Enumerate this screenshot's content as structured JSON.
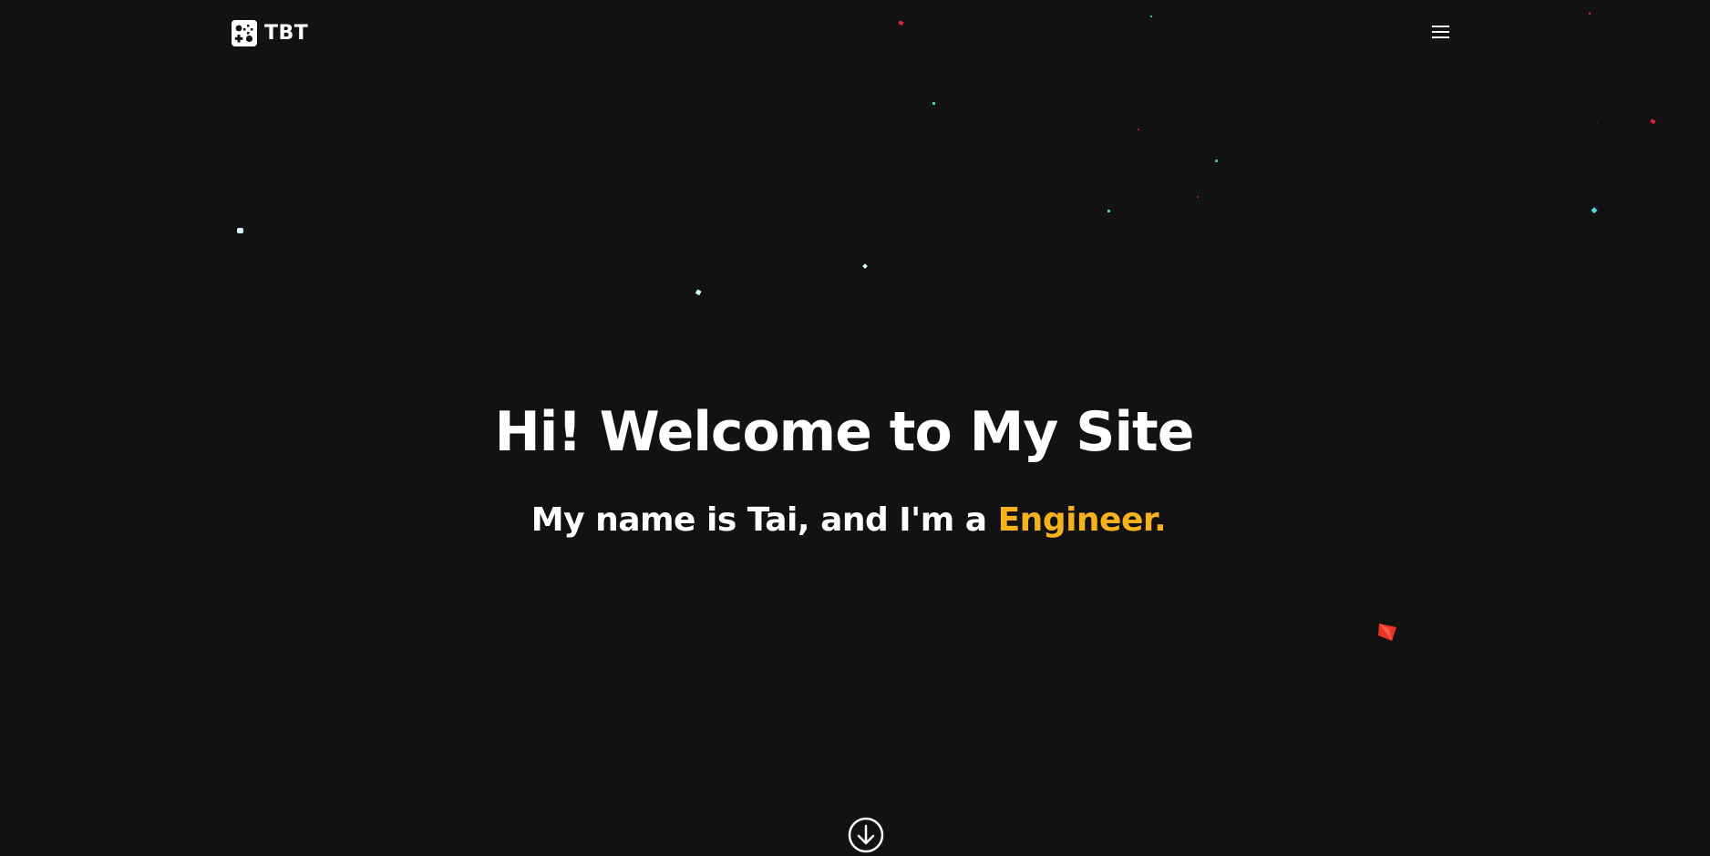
{
  "nav": {
    "brand_text": "TBT",
    "brand_icon": "gamepad-dice-icon",
    "menu_icon": "hamburger-menu-icon"
  },
  "hero": {
    "title": "Hi! Welcome to My Site",
    "subtitle_prefix": "My name is Tai, and I'm a",
    "subtitle_highlight": "Engineer."
  },
  "scroll": {
    "icon": "arrow-down-circle-icon"
  },
  "colors": {
    "background": "#121212",
    "text": "#ffffff",
    "accent": "#f5b21c",
    "particle_cyan": "#5fe3d4",
    "particle_red": "#e02235"
  }
}
